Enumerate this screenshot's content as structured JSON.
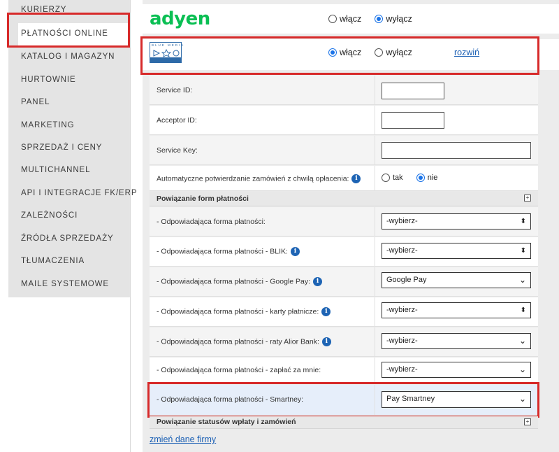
{
  "sidebar": {
    "items": [
      {
        "label": "KURIERZY"
      },
      {
        "label": "PŁATNOŚCI ONLINE"
      },
      {
        "label": "KATALOG I MAGAZYN"
      },
      {
        "label": "HURTOWNIE"
      },
      {
        "label": "PANEL"
      },
      {
        "label": "MARKETING"
      },
      {
        "label": "SPRZEDAŻ I CENY"
      },
      {
        "label": "MULTICHANNEL"
      },
      {
        "label": "API I INTEGRACJE FK/ERP"
      },
      {
        "label": "ZALEŻNOŚCI"
      },
      {
        "label": "ŹRÓDŁA SPRZEDAŻY"
      },
      {
        "label": "TŁUMACZENIA"
      },
      {
        "label": "MAILE SYSTEMOWE"
      }
    ]
  },
  "adyen": {
    "logo_text": "adyen",
    "on_label": "włącz",
    "off_label": "wyłącz",
    "selected": "off"
  },
  "bluemedia": {
    "logo_text": "BLUE MEDIA",
    "on_label": "włącz",
    "off_label": "wyłącz",
    "selected": "on",
    "expand_link": "rozwiń"
  },
  "form": {
    "service_id_label": "Service ID:",
    "acceptor_id_label": "Acceptor ID:",
    "service_key_label": "Service Key:",
    "auto_confirm_label": "Automatyczne potwierdzanie zamówień z chwilą opłacenia:",
    "auto_confirm_yes": "tak",
    "auto_confirm_no": "nie",
    "auto_confirm_selected": "no",
    "section_payment_forms": "Powiązanie form płatności",
    "rows": [
      {
        "label": "- Odpowiadająca forma płatności:",
        "value": "-wybierz-",
        "info": false
      },
      {
        "label": "- Odpowiadająca forma płatności - BLIK:",
        "value": "-wybierz-",
        "info": true
      },
      {
        "label": "- Odpowiadająca forma płatności - Google Pay:",
        "value": "Google Pay",
        "info": true
      },
      {
        "label": "- Odpowiadająca forma płatności - karty płatnicze:",
        "value": "-wybierz-",
        "info": true
      },
      {
        "label": "- Odpowiadająca forma płatności - raty Alior Bank:",
        "value": "-wybierz-",
        "info": true
      },
      {
        "label": "- Odpowiadająca forma płatności - zapłać za mnie:",
        "value": "-wybierz-",
        "info": false
      },
      {
        "label": "- Odpowiadająca forma płatności - Smartney:",
        "value": "Pay Smartney",
        "info": false
      }
    ],
    "section_statuses": "Powiązanie statusów wpłaty i zamówień",
    "info_glyph": "i",
    "plus_glyph": "+"
  },
  "footer": {
    "change_company_link": "zmień dane firmy"
  },
  "colors": {
    "adyen_green": "#0abf53",
    "highlight_red": "#d72a2a",
    "link_blue": "#1a5fb4",
    "radio_blue": "#1a73e8"
  }
}
